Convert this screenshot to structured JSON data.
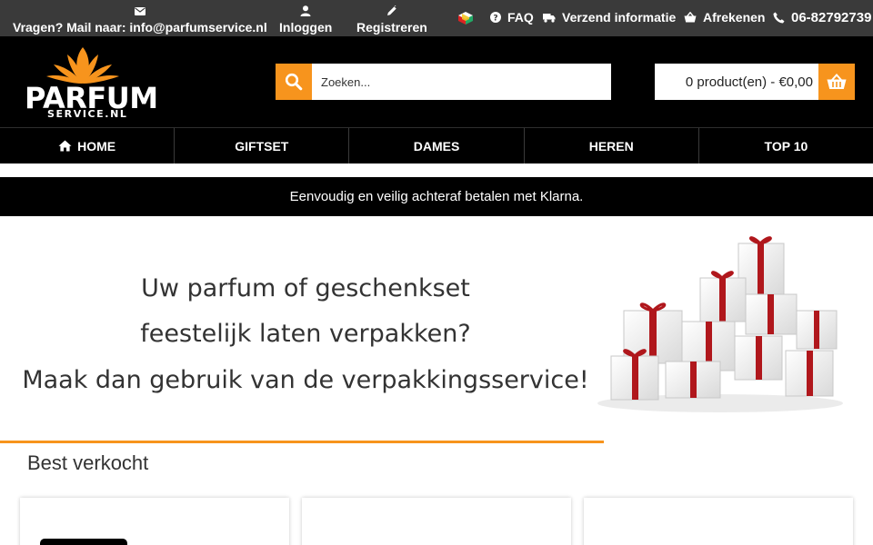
{
  "topbar": {
    "contact": {
      "label": "Vragen? Mail naar: info@parfumservice.nl",
      "icon": "envelope-icon"
    },
    "login": {
      "label": "Inloggen",
      "icon": "user-icon"
    },
    "register": {
      "label": "Registreren",
      "icon": "pencil-icon"
    },
    "links": [
      {
        "label": "FAQ",
        "icon": "question-circle-icon"
      },
      {
        "label": "Verzend informatie",
        "icon": "truck-icon"
      },
      {
        "label": "Afrekenen",
        "icon": "basket-icon"
      }
    ],
    "phone": "06-82792739"
  },
  "logo": {
    "word": "PARFUM",
    "sub": "SERVICE.NL"
  },
  "search": {
    "placeholder": "Zoeken..."
  },
  "cart": {
    "summary": "0 product(en) - €0,00"
  },
  "nav": [
    "HOME",
    "GIFTSET",
    "DAMES",
    "HEREN",
    "TOP 10"
  ],
  "notice": "Eenvoudig en veilig achteraf betalen met Klarna.",
  "banner": {
    "lines": [
      "Uw parfum of geschenkset",
      "feestelijk laten verpakken?",
      "Maak dan gebruik van de verpakkingsservice!"
    ]
  },
  "best_sold": {
    "title": "Best verkocht"
  },
  "colors": {
    "accent": "#f7941d",
    "topbar": "#3a3a3a",
    "header": "#000000"
  }
}
